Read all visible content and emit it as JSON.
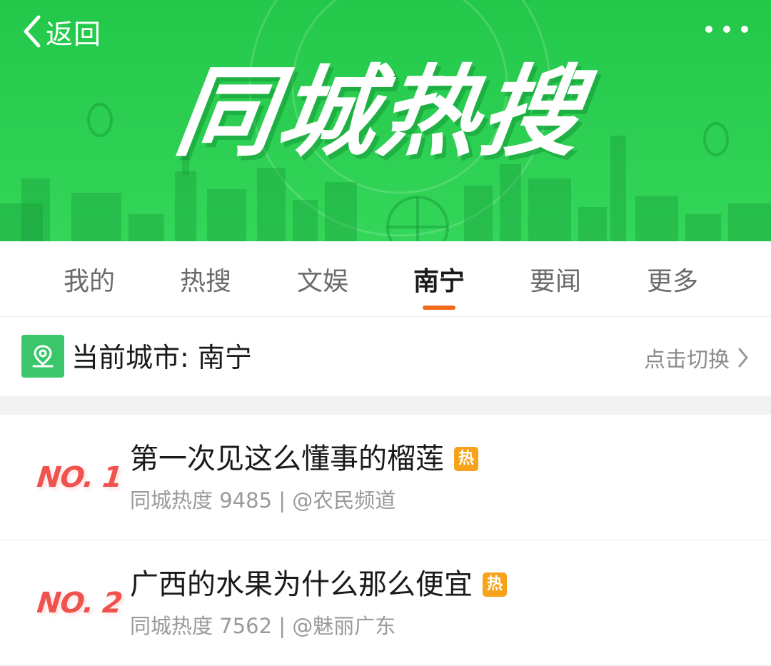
{
  "header": {
    "back_label": "返回",
    "banner_title": "同城热搜"
  },
  "tabs": [
    {
      "label": "我的"
    },
    {
      "label": "热搜"
    },
    {
      "label": "文娱"
    },
    {
      "label": "南宁",
      "active": true
    },
    {
      "label": "要闻"
    },
    {
      "label": "更多"
    }
  ],
  "city_bar": {
    "label": "当前城市: 南宁",
    "switch_label": "点击切换"
  },
  "list": [
    {
      "rank": "NO. 1",
      "title": "第一次见这么懂事的榴莲",
      "badge": "热",
      "meta": "同城热度 9485 | @农民频道"
    },
    {
      "rank": "NO. 2",
      "title": "广西的水果为什么那么便宜",
      "badge": "热",
      "meta": "同城热度 7562 | @魅丽广东"
    }
  ],
  "colors": {
    "banner_green": "#2ccf52",
    "active_indicator": "#f26b1d",
    "rank_red": "#f0524d",
    "hot_badge": "#f7a21b",
    "city_icon_green": "#3cc66b"
  },
  "icons": {
    "back": "chevron-left-icon",
    "more": "more-dots-icon",
    "city": "map-pin-icon",
    "switch": "chevron-right-icon"
  }
}
